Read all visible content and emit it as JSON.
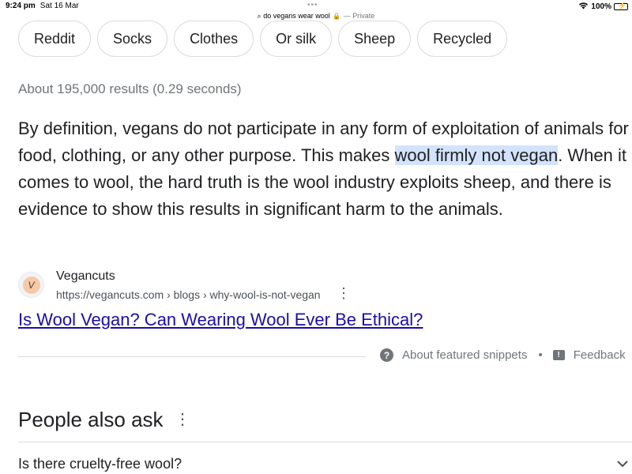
{
  "status_bar": {
    "time": "9:24 pm",
    "date": "Sat 16 Mar",
    "url": "do vegans wear wool",
    "private_label": "— Private",
    "battery": "100%"
  },
  "chips": [
    "Reddit",
    "Socks",
    "Clothes",
    "Or silk",
    "Sheep",
    "Recycled"
  ],
  "stats": "About 195,000 results (0.29 seconds)",
  "snippet": {
    "part1": "By definition, vegans do not participate in any form of exploitation of animals for food, clothing, or any other purpose. This makes ",
    "highlight": "wool firmly not vegan",
    "part2": ". When it comes to wool, the hard truth is the wool industry exploits sheep, and there is evidence to show this results in significant harm to the animals."
  },
  "source": {
    "name": "Vegancuts",
    "url": "https://vegancuts.com › blogs › why-wool-is-not-vegan"
  },
  "result_title": "Is Wool Vegan? Can Wearing Wool Ever Be Ethical?",
  "footer": {
    "about": "About featured snippets",
    "feedback": "Feedback"
  },
  "people_also_ask": {
    "title": "People also ask",
    "questions": [
      "Is there cruelty-free wool?"
    ]
  },
  "colors": {
    "link": "#1a0dab",
    "highlight": "#d3e3fd",
    "muted": "#70757a"
  }
}
